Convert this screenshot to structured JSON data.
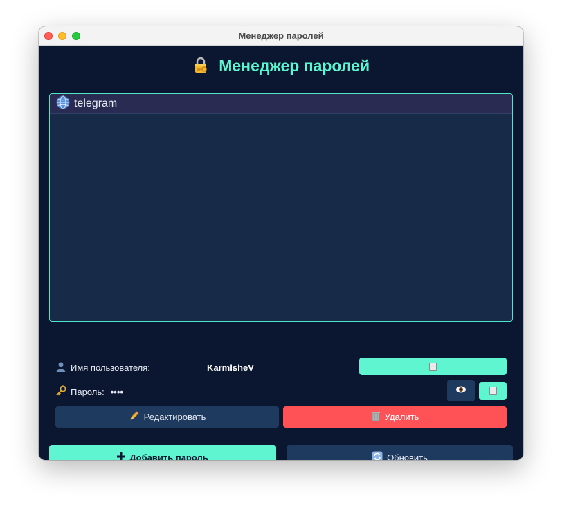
{
  "window": {
    "title": "Менеджер паролей"
  },
  "header": {
    "title": "Менеджер паролей",
    "icon": "lock-with-key-icon"
  },
  "entries": [
    {
      "label": "telegram",
      "icon": "globe-icon"
    }
  ],
  "details": {
    "username_label": "Имя пользователя:",
    "username_value": "KarmlsheV",
    "password_label": "Пароль:",
    "password_value": "••••"
  },
  "actions": {
    "copy_username_icon": "clipboard-icon",
    "show_password_icon": "eye-icon",
    "copy_password_icon": "clipboard-icon",
    "edit_label": "Редактировать",
    "edit_icon": "pencil-icon",
    "delete_label": "Удалить",
    "delete_icon": "trash-icon"
  },
  "footer": {
    "add_label": "Добавить пароль",
    "add_icon": "plus-icon",
    "refresh_label": "Обновить",
    "refresh_icon": "refresh-icon"
  },
  "colors": {
    "background": "#0b1630",
    "accent": "#5ef5d0",
    "panel": "#172a47",
    "button_secondary": "#1e3a5f",
    "danger": "#ff5257"
  }
}
